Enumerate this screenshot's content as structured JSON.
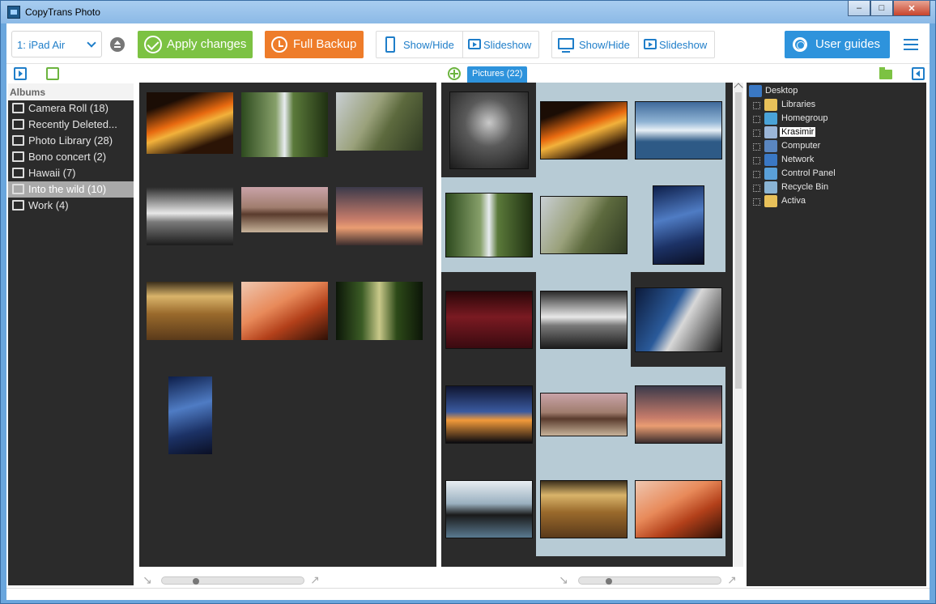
{
  "window": {
    "title": "CopyTrans Photo"
  },
  "toolbar": {
    "device": "1: iPad Air",
    "apply_label": "Apply changes",
    "backup_label": "Full Backup",
    "device_showhide": "Show/Hide",
    "device_slideshow": "Slideshow",
    "pc_showhide": "Show/Hide",
    "pc_slideshow": "Slideshow",
    "guides_label": "User guides"
  },
  "pictures_tab": "Pictures (22)",
  "albums": {
    "header": "Albums",
    "items": [
      {
        "label": "Camera Roll  (18)",
        "icon": "camera-roll-icon",
        "selected": false
      },
      {
        "label": "Recently Deleted...",
        "icon": "trash-icon",
        "selected": false
      },
      {
        "label": "Photo Library  (28)",
        "icon": "camera-icon",
        "selected": false
      },
      {
        "label": "Bono concert  (2)",
        "icon": "album-icon",
        "selected": false
      },
      {
        "label": "Hawaii  (7)",
        "icon": "album-icon",
        "selected": false
      },
      {
        "label": "Into the wild  (10)",
        "icon": "album-icon",
        "selected": true
      },
      {
        "label": "Work  (4)",
        "icon": "album-icon",
        "selected": false
      }
    ]
  },
  "tree": {
    "items": [
      {
        "label": "Desktop",
        "icon": "desktop-icon",
        "color": "#3a78c4",
        "level": 0
      },
      {
        "label": "Libraries",
        "icon": "libraries-icon",
        "color": "#e8c15a",
        "level": 1
      },
      {
        "label": "Homegroup",
        "icon": "homegroup-icon",
        "color": "#4aa3d8",
        "level": 1
      },
      {
        "label": "Krasimir",
        "icon": "user-folder-icon",
        "color": "#9bb6d8",
        "level": 1,
        "selected": true
      },
      {
        "label": "Computer",
        "icon": "computer-icon",
        "color": "#5a86c0",
        "level": 1
      },
      {
        "label": "Network",
        "icon": "network-icon",
        "color": "#3a78c4",
        "level": 1
      },
      {
        "label": "Control Panel",
        "icon": "control-panel-icon",
        "color": "#5aa0d8",
        "level": 1
      },
      {
        "label": "Recycle Bin",
        "icon": "recycle-bin-icon",
        "color": "#8ab4d4",
        "level": 1
      },
      {
        "label": "Activa",
        "icon": "folder-icon",
        "color": "#e8c15a",
        "level": 1
      }
    ]
  },
  "colors": {
    "accent_blue": "#2e93dc",
    "apply_green": "#7cc243",
    "backup_orange": "#ee7c2a",
    "panel_dark": "#2b2b2b",
    "selection": "#b7cbd5"
  }
}
